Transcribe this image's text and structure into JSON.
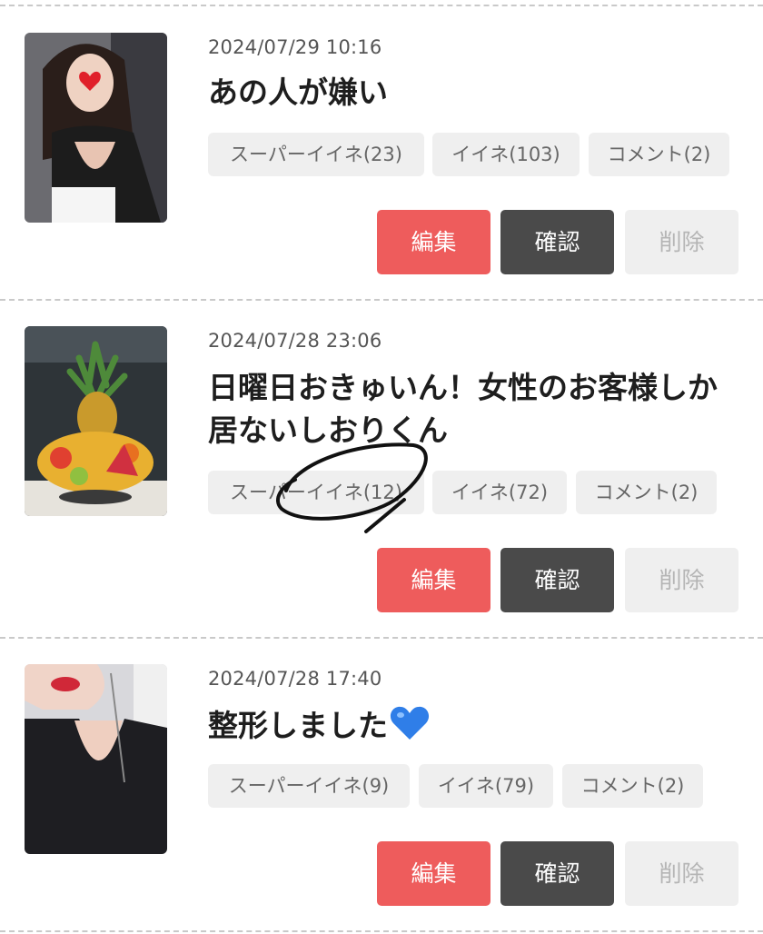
{
  "posts": [
    {
      "date": "2024/07/29 10:16",
      "title": "あの人が嫌い",
      "super_like": "スーパーイイネ(23)",
      "like": "イイネ(103)",
      "comment": "コメント(2)",
      "edit": "編集",
      "confirm": "確認",
      "delete": "削除"
    },
    {
      "date": "2024/07/28 23:06",
      "title": "日曜日おきゅいん！女性のお客様しか居ないしおりくん",
      "super_like": "スーパーイイネ(12)",
      "like": "イイネ(72)",
      "comment": "コメント(2)",
      "edit": "編集",
      "confirm": "確認",
      "delete": "削除"
    },
    {
      "date": "2024/07/28 17:40",
      "title": "整形しました",
      "title_emoji": "blue-heart-icon",
      "super_like": "スーパーイイネ(9)",
      "like": "イイネ(79)",
      "comment": "コメント(2)",
      "edit": "編集",
      "confirm": "確認",
      "delete": "削除"
    }
  ],
  "colors": {
    "edit_button": "#ee5c5c",
    "confirm_button": "#4a4a4a",
    "delete_button": "#efefef",
    "chip_background": "#efefef"
  }
}
